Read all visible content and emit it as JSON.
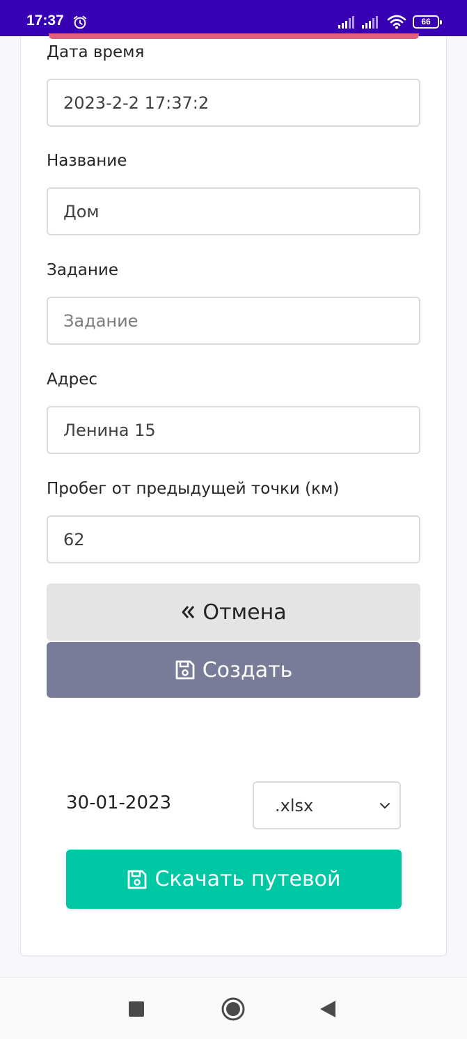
{
  "status_bar": {
    "time": "17:37",
    "battery": "66",
    "icons": [
      "alarm-icon",
      "signal-icon",
      "signal-icon",
      "wifi-icon",
      "battery-icon"
    ],
    "background": "#3700b3"
  },
  "form": {
    "datetime": {
      "label": "Дата время",
      "value": "2023-2-2 17:37:2"
    },
    "name": {
      "label": "Название",
      "value": "Дом"
    },
    "task": {
      "label": "Задание",
      "value": "",
      "placeholder": "Задание"
    },
    "address": {
      "label": "Адрес",
      "value": "Ленина 15"
    },
    "mileage": {
      "label": "Пробег от предыдущей точки (км)",
      "value": "62"
    },
    "cancel_label": "Отмена",
    "cancel_icon": "double-chevron-left-icon",
    "create_label": "Создать",
    "create_icon": "floppy-disk-icon"
  },
  "export": {
    "date": "30-01-2023",
    "format_selected": ".xlsx",
    "format_options": [
      ".xlsx"
    ],
    "download_label": "Скачать путевой",
    "download_icon": "floppy-disk-icon"
  },
  "colors": {
    "accent": "#e35d7f",
    "create_button": "#787c99",
    "download_button": "#00c8a4",
    "cancel_button": "#e4e4e4"
  },
  "nav_bar": {
    "icons": [
      "recent-apps-icon",
      "home-icon",
      "back-icon"
    ]
  }
}
